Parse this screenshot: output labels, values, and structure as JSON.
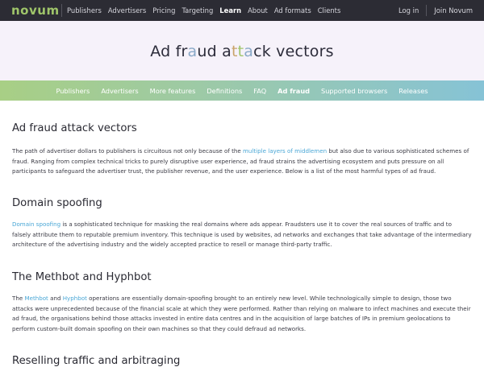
{
  "topnav": {
    "logo": "novum",
    "links": [
      "Publishers",
      "Advertisers",
      "Pricing",
      "Targeting",
      "Learn",
      "About",
      "Ad formats",
      "Clients"
    ],
    "active": "Learn",
    "login": "Log in",
    "join": "Join Novum"
  },
  "hero": {
    "title_parts": [
      "Ad fr",
      "a",
      "ud a",
      "t",
      "t",
      "a",
      "ck vectors"
    ]
  },
  "subnav": {
    "items": [
      "Publishers",
      "Advertisers",
      "More features",
      "Definitions",
      "FAQ",
      "Ad fraud",
      "Supported browsers",
      "Releases"
    ],
    "active": "Ad fraud"
  },
  "sections": {
    "s1": {
      "title": "Ad fraud attack vectors",
      "text_a": "The path of advertiser dollars to publishers is circuitous not only because of the ",
      "link": "multiple layers of middlemen",
      "text_b": " but also due to various sophisticated schemes of fraud. Ranging from complex technical tricks to purely disruptive user experience, ad fraud strains the advertising ecosystem and puts pressure on all participants to safeguard the advertiser trust, the publisher revenue, and the user experience. Below is a list of the most harmful types of ad fraud."
    },
    "s2": {
      "title": "Domain spoofing",
      "link": "Domain spoofing",
      "text": " is a sophisticated technique for masking the real domains where ads appear. Fraudsters use it to cover the real sources of traffic and to falsely attribute them to reputable premium inventory. This technique is used by websites, ad networks and exchanges that take advantage of the intermediary architecture of the advertising industry and the widely accepted practice to resell or manage third-party traffic."
    },
    "s3": {
      "title": "The Methbot and Hyphbot",
      "text_a": "The ",
      "link1": "Methbot",
      "text_b": " and ",
      "link2": "Hyphbot",
      "text_c": " operations are essentially domain-spoofing brought to an entirely new level. While technologically simple to design, those two attacks were unprecedented because of the financial scale at which they were performed. Rather than relying on malware to infect machines and execute their ad fraud, the organisations behind those attacks invested in entire data centres and in the acquisition of large batches of IPs in premium geolocations to perform custom-built domain spoofing on their own machines so that they could defraud ad networks."
    },
    "s4": {
      "title": "Reselling traffic and arbitraging"
    }
  },
  "colors": {
    "topnav_bg": "#2c2c34",
    "hero_bg": "#f6f2fa",
    "subnav_gradient_start": "#a8cf85",
    "subnav_gradient_end": "#86c3d6",
    "link": "#4aa7d6",
    "logo": "#9fc56a"
  }
}
